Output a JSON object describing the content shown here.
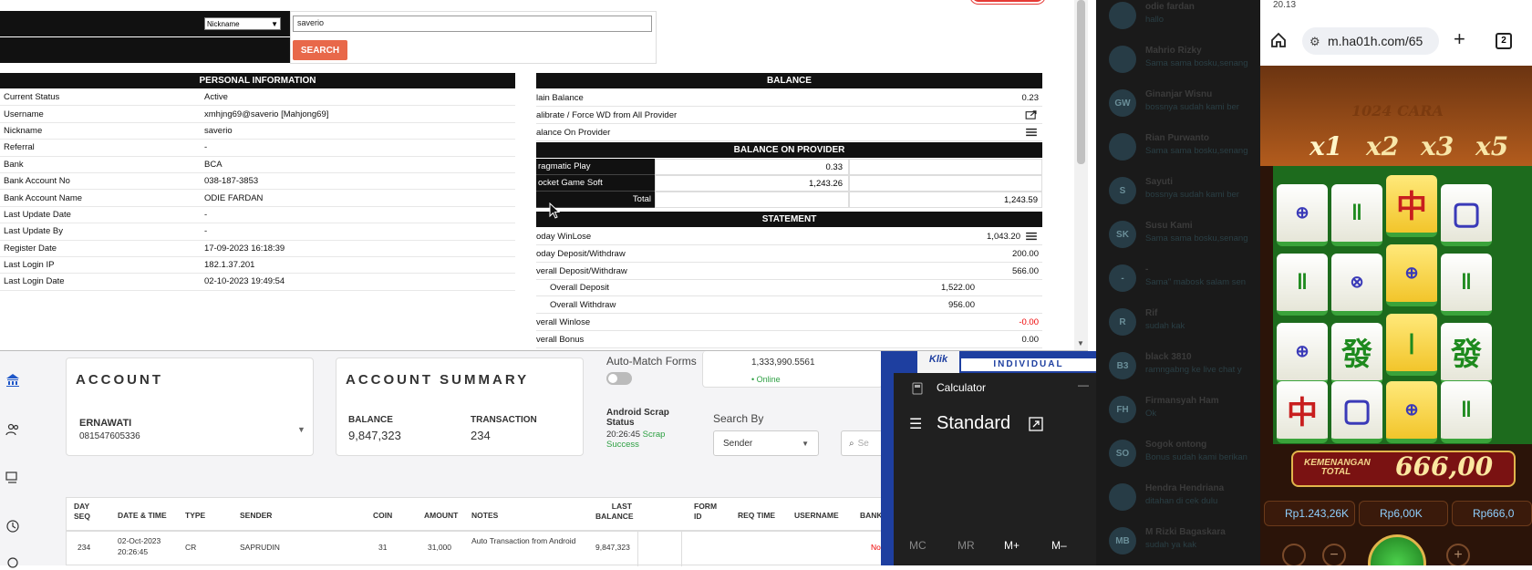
{
  "search": {
    "select_value": "Nickname",
    "input_value": "saverio",
    "button_label": "SEARCH"
  },
  "personal": {
    "heading": "PERSONAL INFORMATION",
    "rows": [
      {
        "k": "Current Status",
        "v": "Active"
      },
      {
        "k": "Username",
        "v": "xmhjng69@saverio  [Mahjong69]"
      },
      {
        "k": "Nickname",
        "v": "saverio"
      },
      {
        "k": "Referral",
        "v": "-"
      },
      {
        "k": "Bank",
        "v": "BCA"
      },
      {
        "k": "Bank Account No",
        "v": "038-187-3853"
      },
      {
        "k": "Bank Account Name",
        "v": "ODIE FARDAN"
      },
      {
        "k": "Last Update Date",
        "v": "-"
      },
      {
        "k": "Last Update By",
        "v": "-"
      },
      {
        "k": "Register Date",
        "v": "17-09-2023 16:18:39"
      },
      {
        "k": "Last Login IP",
        "v": "182.1.37.201"
      },
      {
        "k": "Last Login Date",
        "v": "02-10-2023 19:49:54"
      }
    ]
  },
  "balance": {
    "heading": "BALANCE",
    "main_label": "lain Balance",
    "main_value": "0.23",
    "calibrate_label": "alibrate / Force WD from All Provider",
    "on_provider_label": "alance On Provider",
    "provider_heading": "BALANCE ON PROVIDER",
    "providers": [
      {
        "name": "ragmatic Play",
        "value": "0.33"
      },
      {
        "name": "ocket Game Soft",
        "value": "1,243.26"
      }
    ],
    "total_label": "Total",
    "total_value": "1,243.59",
    "statement_heading": "STATEMENT",
    "statement": [
      {
        "k": "oday WinLose",
        "v": "1,043.20"
      },
      {
        "k": "oday Deposit/Withdraw",
        "v": "200.00"
      },
      {
        "k": "verall Deposit/Withdraw",
        "v": "566.00"
      },
      {
        "k": "Overall Deposit",
        "v": "1,522.00"
      },
      {
        "k": "Overall Withdraw",
        "v": "956.00"
      },
      {
        "k": "verall Winlose",
        "v": "-0.00"
      },
      {
        "k": "verall Bonus",
        "v": "0.00"
      }
    ]
  },
  "dashboard": {
    "account_title": "ACCOUNT",
    "account_name": "ERNAWATI",
    "account_phone": "081547605336",
    "summary_title": "ACCOUNT SUMMARY",
    "balance_label": "BALANCE",
    "balance_value": "9,847,323",
    "transaction_label": "TRANSACTION",
    "transaction_value": "234",
    "auto_match_label": "Auto-Match Forms",
    "device_value": "1,333,990.5561",
    "online_label": "• Online",
    "scrap_label": "Android Scrap Status",
    "scrap_time": "20:26:45",
    "scrap_status": "Scrap Success",
    "search_by_label": "Search By",
    "search_by_value": "Sender",
    "search_placeholder": "Se",
    "headers": [
      "DAY SEQ",
      "DATE & TIME",
      "TYPE",
      "SENDER",
      "COIN",
      "AMOUNT",
      "NOTES",
      "LAST BALANCE",
      "FORM ID",
      "REQ TIME",
      "USERNAME",
      "BANK"
    ],
    "row": {
      "seq": "234",
      "date": "02-Oct-2023 20:26:45",
      "type": "CR",
      "sender": "SAPRUDIN",
      "coin": "31",
      "amount": "31,000",
      "notes": "Auto Transaction from Android",
      "last_balance": "9,847,323",
      "bank": "No"
    }
  },
  "banner": {
    "label1": "Klik",
    "label2": "INDIVIDUAL"
  },
  "calculator": {
    "title": "Calculator",
    "mode": "Standard",
    "memory_buttons": [
      "MC",
      "MR",
      "M+",
      "M–"
    ]
  },
  "chat": [
    {
      "initials": "",
      "name": "odie fardan",
      "msg": "hallo"
    },
    {
      "initials": "",
      "name": "Mahrio Rizky",
      "msg": "Sama sama bosku,senang"
    },
    {
      "initials": "GW",
      "name": "Ginanjar Wisnu",
      "msg": "bossnya sudah kami ber"
    },
    {
      "initials": "",
      "name": "Rian Purwanto",
      "msg": "Sama sama bosku,senang"
    },
    {
      "initials": "S",
      "name": "Sayuti",
      "msg": "bossnya sudah kami ber"
    },
    {
      "initials": "SK",
      "name": "Susu Kami",
      "msg": "Sama sama bosku,senang"
    },
    {
      "initials": "-",
      "name": "-",
      "msg": "Sama\" mabosk salam sen"
    },
    {
      "initials": "R",
      "name": "Rif",
      "msg": "sudah kak"
    },
    {
      "initials": "B3",
      "name": "black 3810",
      "msg": "ramngabng ke live chat y"
    },
    {
      "initials": "FH",
      "name": "Firmansyah Ham",
      "msg": "Ok"
    },
    {
      "initials": "SO",
      "name": "Sogok ontong",
      "msg": "Bonus sudah kami berikan"
    },
    {
      "initials": "",
      "name": "Hendra Hendriana",
      "msg": "ditahan di cek dulu"
    },
    {
      "initials": "MB",
      "name": "M Rizki Bagaskara",
      "msg": "sudah ya kak"
    }
  ],
  "phone": {
    "clock": "20.13",
    "url": "m.ha01h.com/65",
    "tab_count": "2",
    "title": "1024 CARA",
    "multipliers": [
      "x1",
      "x2",
      "x3",
      "x5"
    ],
    "win_label": "KEMENANGAN TOTAL",
    "win_value": "666,00",
    "stats": [
      "Rp1.243,26K",
      "Rp6,00K",
      "Rp666,0"
    ]
  }
}
